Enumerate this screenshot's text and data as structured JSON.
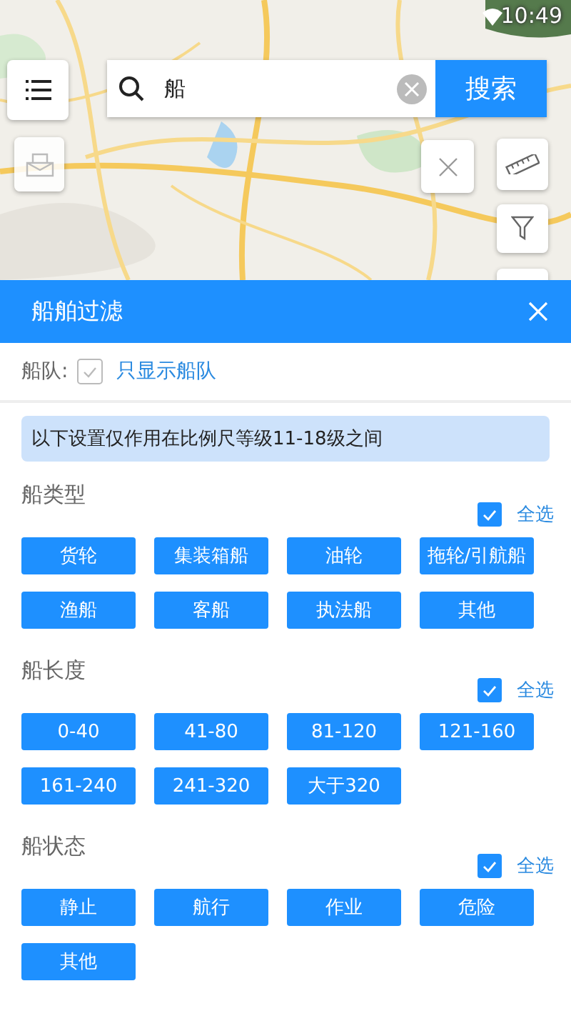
{
  "status_bar": {
    "time": "10:49"
  },
  "search": {
    "value": "船",
    "button": "搜索"
  },
  "panel": {
    "title": "船舶过滤",
    "fleet": {
      "label": "船队:",
      "checked": false,
      "option": "只显示船队"
    },
    "notice": "以下设置仅作用在比例尺等级11-18级之间",
    "sections": [
      {
        "title": "船类型",
        "select_all": {
          "label": "全选",
          "checked": true
        },
        "options": [
          {
            "label": "货轮",
            "selected": true
          },
          {
            "label": "集装箱船",
            "selected": true
          },
          {
            "label": "油轮",
            "selected": true
          },
          {
            "label": "拖轮/引航船",
            "selected": true
          },
          {
            "label": "渔船",
            "selected": true
          },
          {
            "label": "客船",
            "selected": true
          },
          {
            "label": "执法船",
            "selected": true
          },
          {
            "label": "其他",
            "selected": true
          }
        ]
      },
      {
        "title": "船长度",
        "select_all": {
          "label": "全选",
          "checked": true
        },
        "options": [
          {
            "label": "0-40",
            "selected": true
          },
          {
            "label": "41-80",
            "selected": true
          },
          {
            "label": "81-120",
            "selected": true
          },
          {
            "label": "121-160",
            "selected": true
          },
          {
            "label": "161-240",
            "selected": true
          },
          {
            "label": "241-320",
            "selected": true
          },
          {
            "label": "大于320",
            "selected": true
          }
        ]
      },
      {
        "title": "船状态",
        "select_all": {
          "label": "全选",
          "checked": true
        },
        "options": [
          {
            "label": "静止",
            "selected": true
          },
          {
            "label": "航行",
            "selected": true
          },
          {
            "label": "作业",
            "selected": true
          },
          {
            "label": "危险",
            "selected": true
          },
          {
            "label": "其他",
            "selected": true
          }
        ]
      }
    ]
  }
}
